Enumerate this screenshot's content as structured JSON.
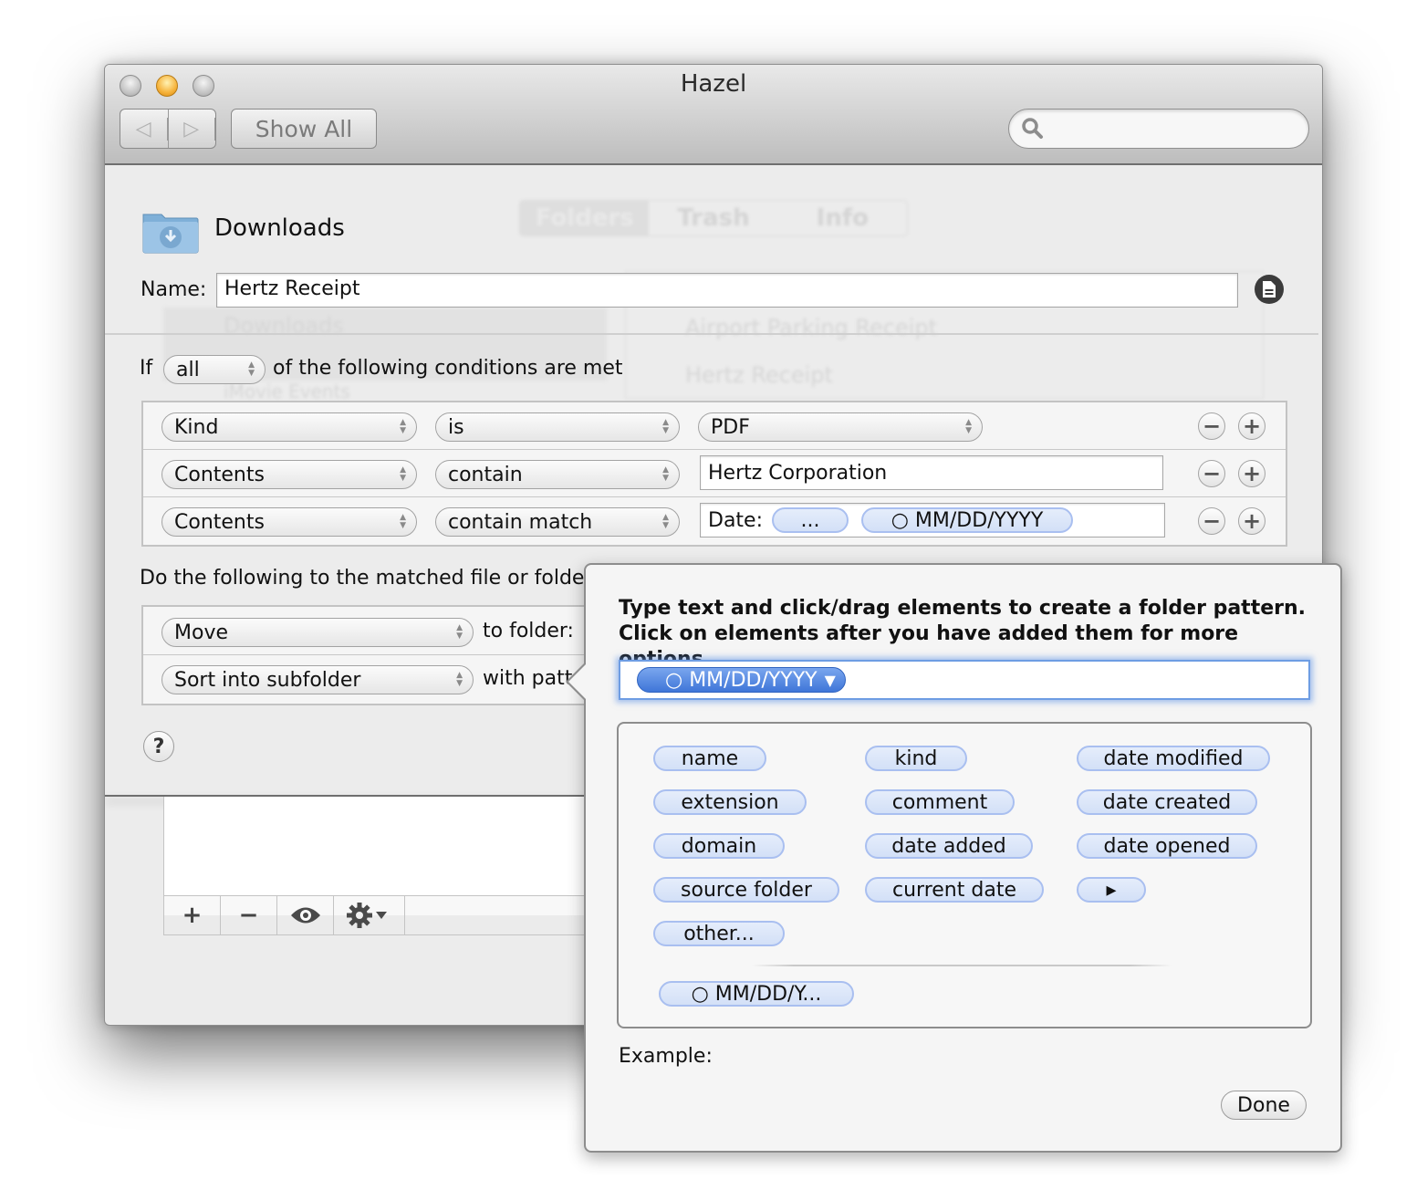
{
  "window": {
    "title": "Hazel",
    "nav": {
      "back_icon": "triangle-left",
      "forward_icon": "triangle-right"
    },
    "show_all_label": "Show All",
    "search": {
      "placeholder": "",
      "value": ""
    }
  },
  "background_ghost": {
    "tabs": [
      "Folders",
      "Trash",
      "Info"
    ],
    "folders": [
      "Downloads",
      "iMovie Events"
    ],
    "rules": [
      "Airport Parking Receipt",
      "Hertz Receipt"
    ]
  },
  "rule_editor": {
    "folder_name": "Downloads",
    "name_label": "Name:",
    "name_value": "Hertz Receipt",
    "if_label": "If",
    "match_mode": "all",
    "conditions_suffix": "of the following conditions are met",
    "conditions": [
      {
        "attribute": "Kind",
        "operator": "is",
        "value_type": "popup",
        "value": "PDF"
      },
      {
        "attribute": "Contents",
        "operator": "contain",
        "value_type": "text",
        "value": "Hertz Corporation"
      },
      {
        "attribute": "Contents",
        "operator": "contain match",
        "value_type": "tokens",
        "prefix": "Date:",
        "tokens": [
          "...",
          "○ MM/DD/YYYY"
        ]
      }
    ],
    "actions_label": "Do the following to the matched file or folder:",
    "actions": [
      {
        "action": "Move",
        "suffix": "to folder:"
      },
      {
        "action": "Sort into subfolder",
        "suffix": "with pattern"
      }
    ],
    "help_label": "?"
  },
  "list_toolbar": {
    "add": "+",
    "remove": "−",
    "preview_icon": "eye-icon",
    "gear_icon": "gear-icon"
  },
  "popover": {
    "instructions": "Type text and click/drag elements to create a folder pattern. Click on elements after you have added them for more options.",
    "pattern_tokens": [
      "○ MM/DD/YYYY"
    ],
    "elements": [
      [
        "name",
        "kind",
        "date modified"
      ],
      [
        "extension",
        "comment",
        "date created"
      ],
      [
        "domain",
        "date added",
        "date opened"
      ],
      [
        "source folder",
        "current date",
        "▸"
      ],
      [
        "other..."
      ]
    ],
    "custom_tokens": [
      "○ MM/DD/Y..."
    ],
    "example_label": "Example:",
    "example_value": "",
    "done_label": "Done"
  },
  "colors": {
    "token_fill": "#d8e4f8",
    "token_border": "#a9bff0",
    "selected_token": "#3f76d8",
    "focus_ring": "#6e9de3"
  }
}
